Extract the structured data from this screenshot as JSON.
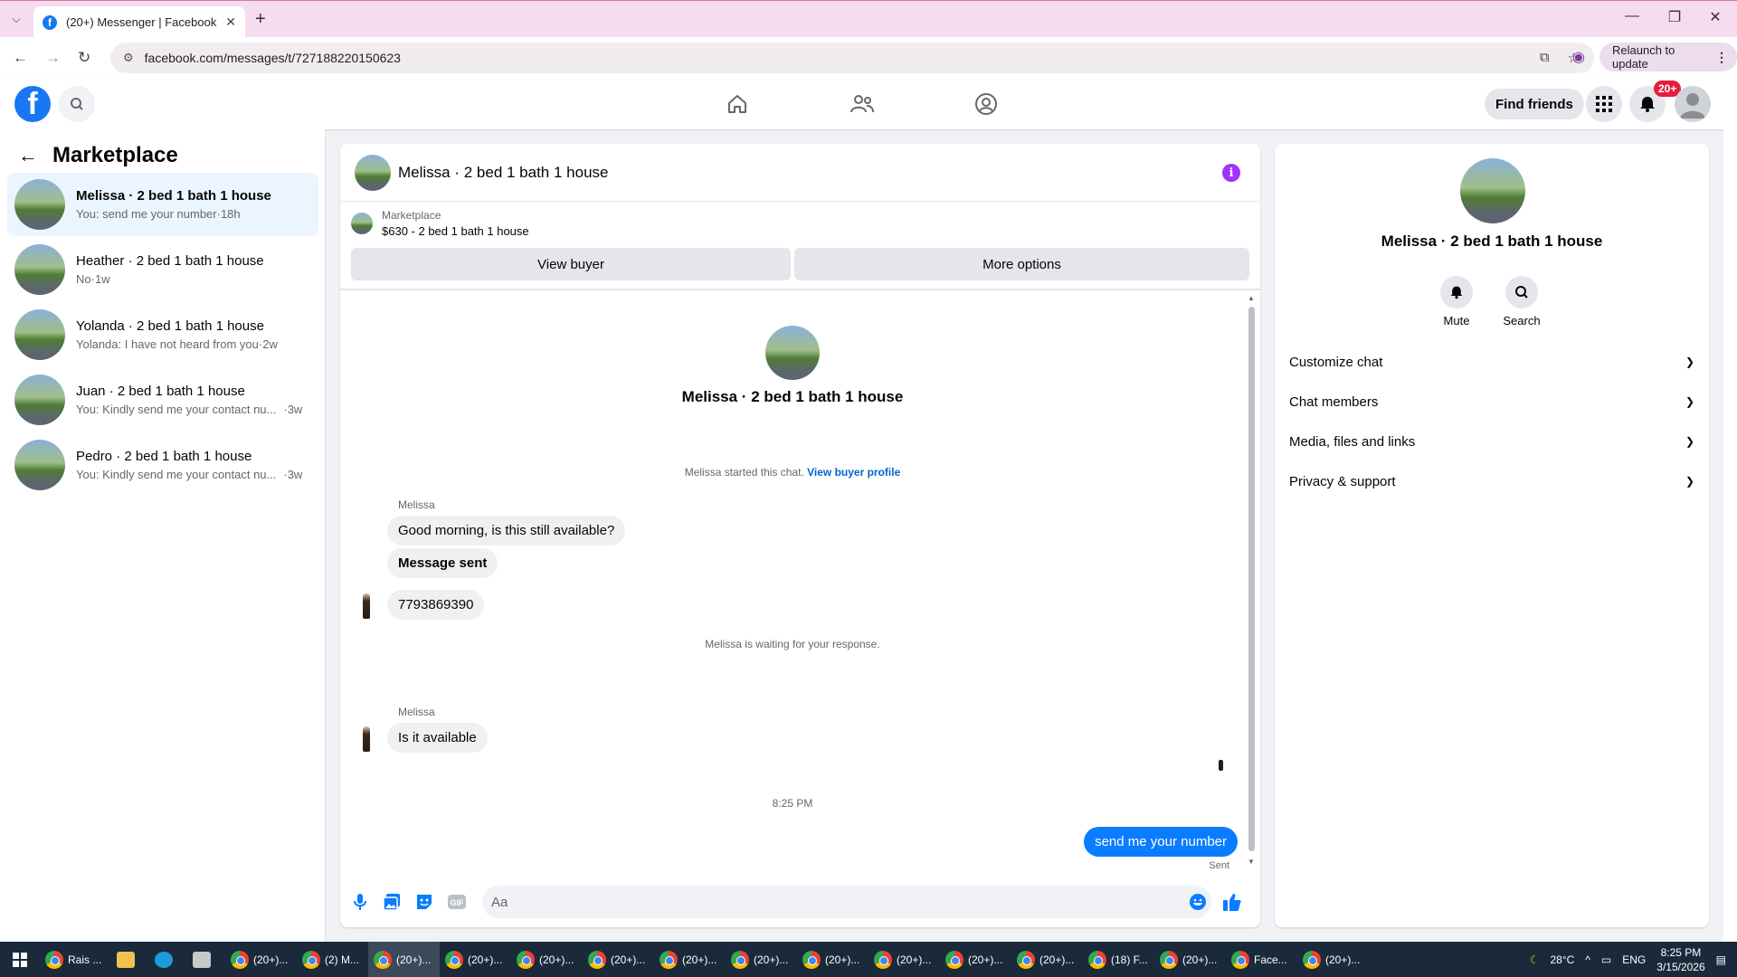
{
  "browser": {
    "tab_title": "(20+) Messenger | Facebook",
    "url": "facebook.com/messages/t/727188220150623",
    "relaunch_label": "Relaunch to update"
  },
  "fb_header": {
    "find_friends": "Find friends",
    "notif_badge": "20+"
  },
  "left_panel": {
    "title": "Marketplace",
    "conversations": [
      {
        "name": "Melissa · 2 bed 1 bath 1 house",
        "snippet": "You: send me your number",
        "time": "·18h"
      },
      {
        "name": "Heather · 2 bed 1 bath 1 house",
        "snippet": "No",
        "time": "·1w"
      },
      {
        "name": "Yolanda · 2 bed 1 bath 1 house",
        "snippet": "Yolanda: I have not heard from you",
        "time": "·2w"
      },
      {
        "name": "Juan · 2 bed 1 bath 1 house",
        "snippet": "You: Kindly send me your contact nu...",
        "time": "·3w"
      },
      {
        "name": "Pedro · 2 bed 1 bath 1 house",
        "snippet": "You: Kindly send me your contact nu...",
        "time": "·3w"
      }
    ]
  },
  "chat": {
    "header_name": "Melissa · 2 bed 1 bath 1 house",
    "marketplace_label": "Marketplace",
    "listing": "$630 - 2 bed 1 bath 1 house",
    "view_buyer": "View buyer",
    "more_options": "More options",
    "intro_name": "Melissa · 2 bed 1 bath 1 house",
    "started_text": "Melissa started this chat.",
    "view_buyer_profile": "View buyer profile",
    "sender1": "Melissa",
    "msg1": "Good morning, is this still available?",
    "msg2": "Message sent",
    "msg3": "7793869390",
    "waiting_text": "Melissa is waiting for your response.",
    "sender2": "Melissa",
    "msg4": "Is it available",
    "timestamp": "8:25 PM",
    "my_msg": "send me your number",
    "sent_label": "Sent",
    "composer_placeholder": "Aa"
  },
  "right_panel": {
    "name": "Melissa · 2 bed 1 bath 1 house",
    "mute": "Mute",
    "search": "Search",
    "items": [
      "Customize chat",
      "Chat members",
      "Media, files and links",
      "Privacy & support"
    ]
  },
  "taskbar": {
    "items": [
      "Rais ...",
      "(20+)...",
      "(2) M...",
      "(20+)...",
      "(20+)...",
      "(20+)...",
      "(20+)...",
      "(20+)...",
      "(20+)...",
      "(20+)...",
      "(20+)...",
      "(20+)...",
      "(20+)...",
      "(18) F...",
      "(20+)...",
      "Face...",
      "(20+)..."
    ],
    "weather": "28°C",
    "lang": "ENG",
    "time": "8:25 PM",
    "date": "3/15/2026"
  }
}
